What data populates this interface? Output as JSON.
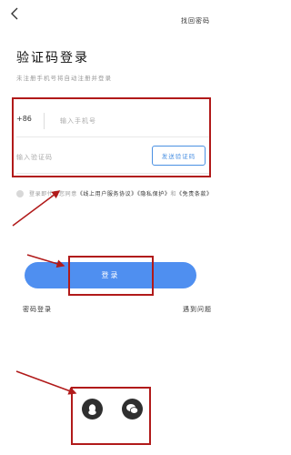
{
  "header": {
    "back_icon": "back-chevron-icon",
    "find_password": "找回密码"
  },
  "title": "验证码登录",
  "subtitle": "未注册手机号将自动注册并登录",
  "phone": {
    "prefix": "+86",
    "placeholder": "输入手机号"
  },
  "code": {
    "placeholder": "输入验证码",
    "send_button": "发送验证码"
  },
  "agreement": {
    "prefix": "登录即代表您同意",
    "user_agreement": "《线上用户服务协议》",
    "privacy": "《隐私保护》",
    "and": "和",
    "disclaimer": "《免责条款》"
  },
  "login_button": "登录",
  "footer_links": {
    "password_login": "密码登录",
    "problem": "遇到问题"
  },
  "social": {
    "qq_icon": "qq-icon",
    "wechat_icon": "wechat-icon"
  },
  "colors": {
    "accent": "#4f8ff0",
    "annotation": "#b11a1a"
  }
}
